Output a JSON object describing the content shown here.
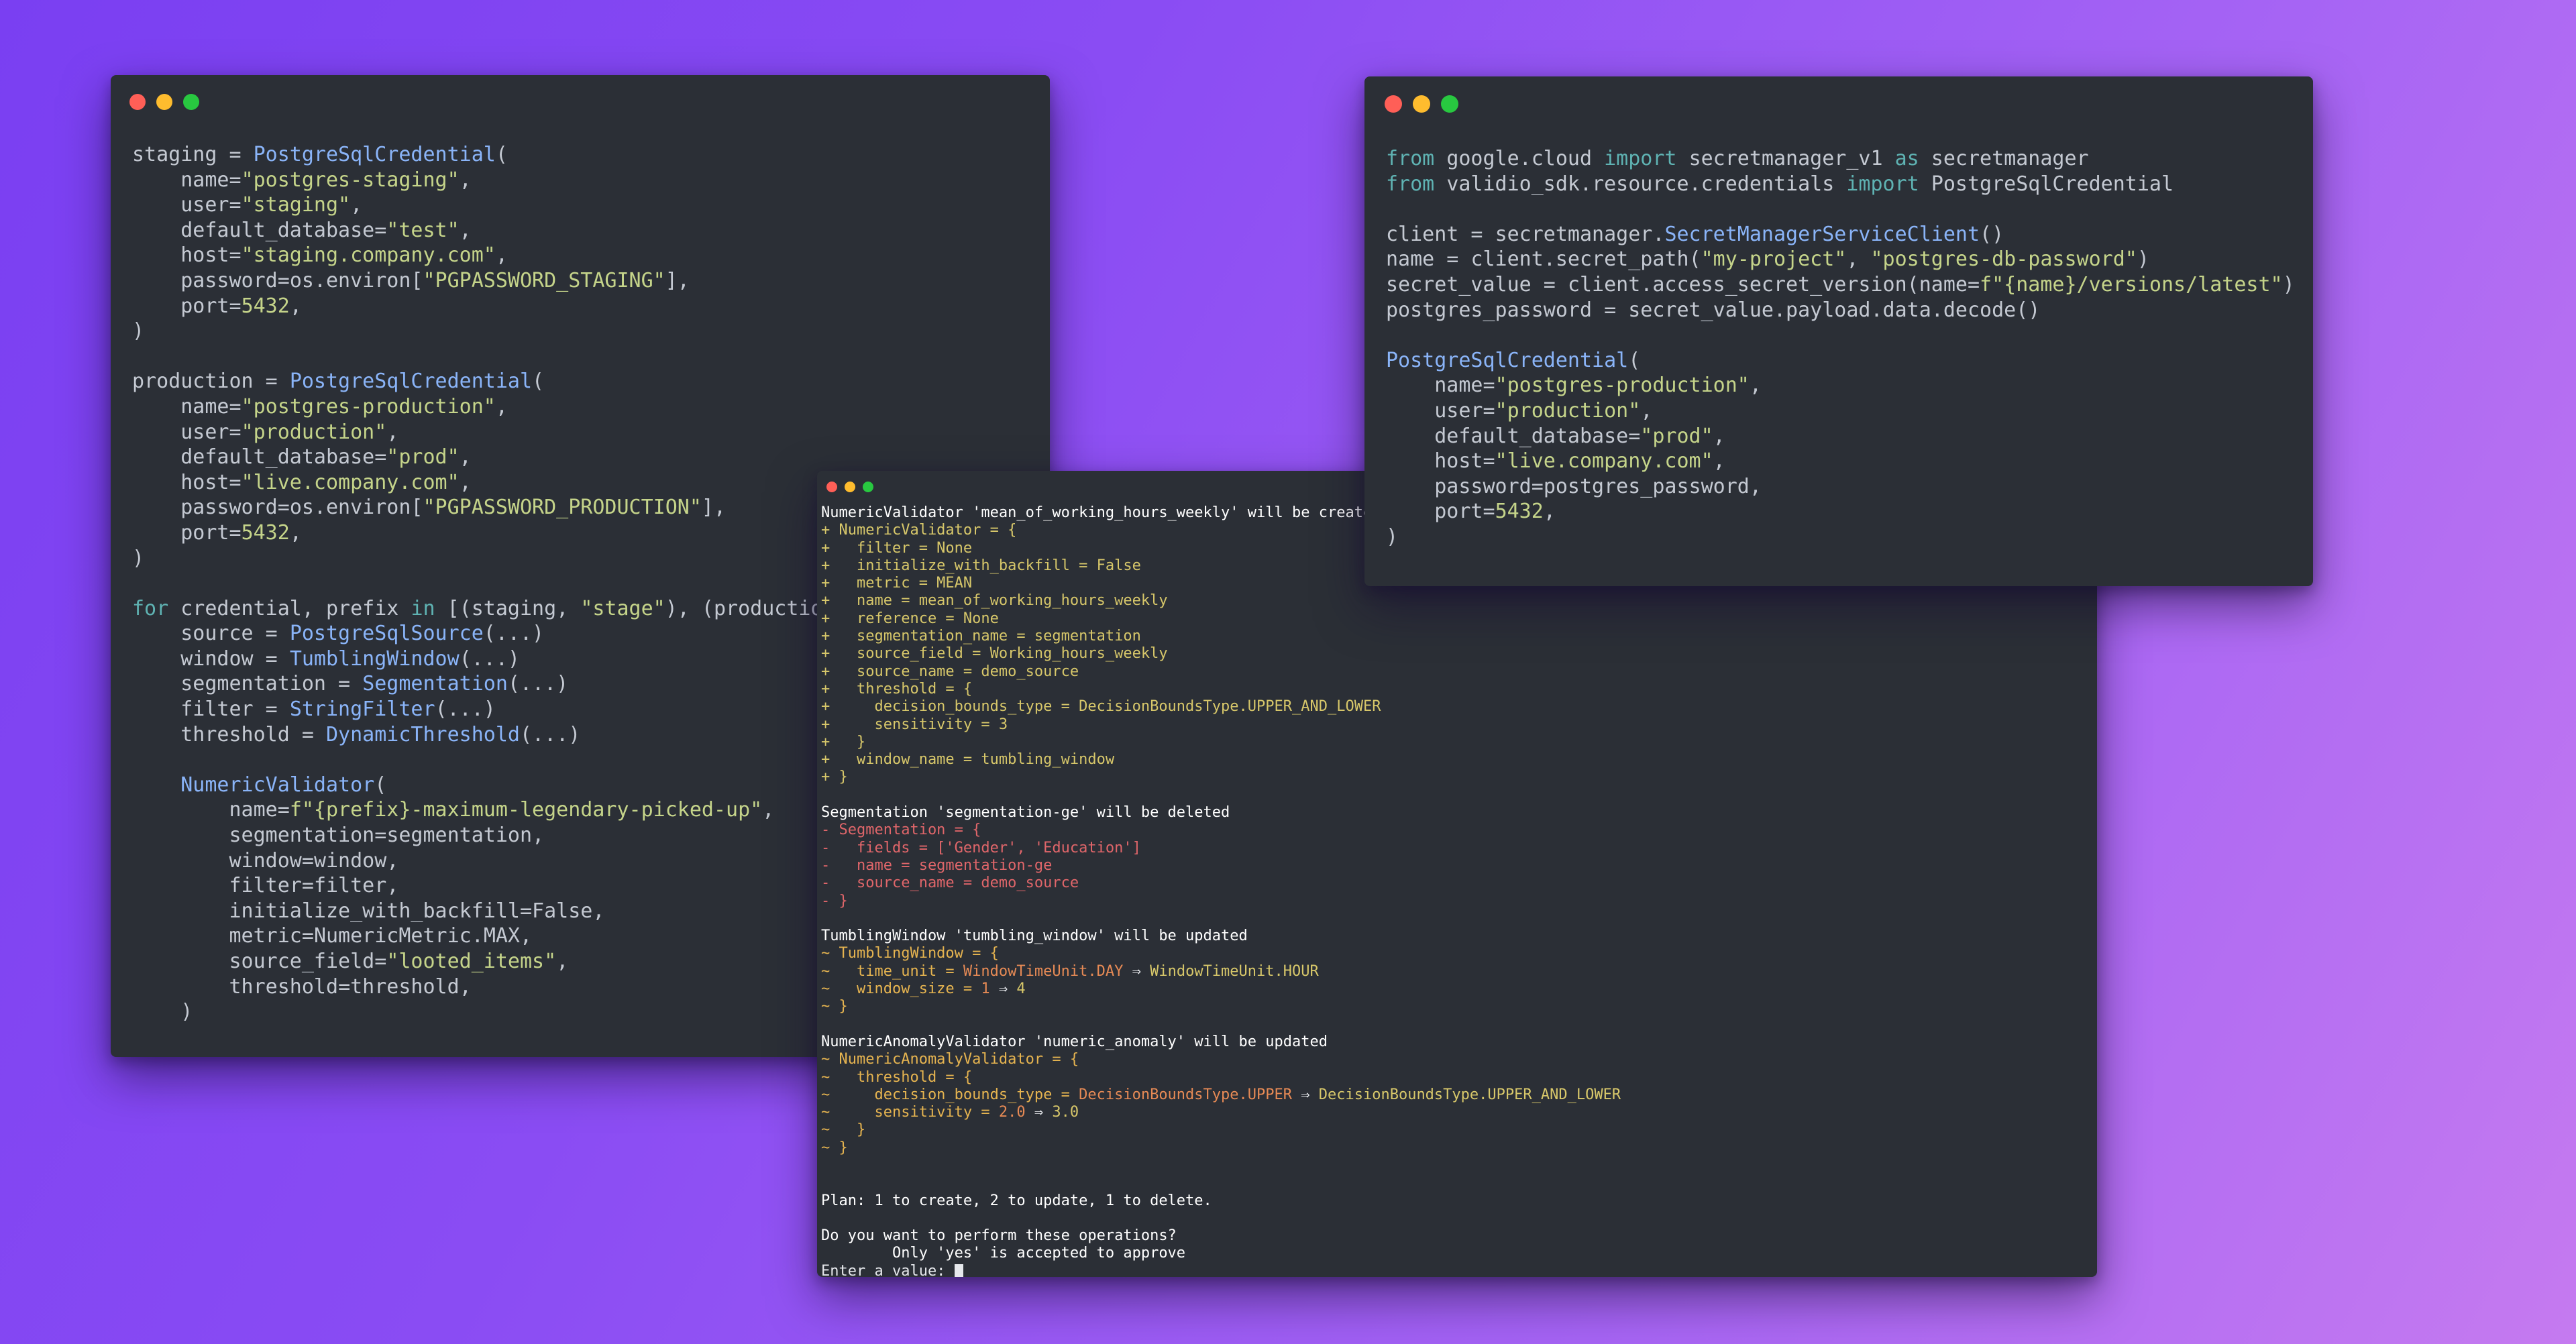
{
  "windows": {
    "left_editor": {
      "lines": [
        "staging = PostgreSqlCredential(",
        "    name=\"postgres-staging\",",
        "    user=\"staging\",",
        "    default_database=\"test\",",
        "    host=\"staging.company.com\",",
        "    password=os.environ[\"PGPASSWORD_STAGING\"],",
        "    port=5432,",
        ")",
        "",
        "production = PostgreSqlCredential(",
        "    name=\"postgres-production\",",
        "    user=\"production\",",
        "    default_database=\"prod\",",
        "    host=\"live.company.com\",",
        "    password=os.environ[\"PGPASSWORD_PRODUCTION\"],",
        "    port=5432,",
        ")",
        "",
        "for credential, prefix in [(staging, \"stage\"), (production,",
        "    source = PostgreSqlSource(...)",
        "    window = TumblingWindow(...)",
        "    segmentation = Segmentation(...)",
        "    filter = StringFilter(...)",
        "    threshold = DynamicThreshold(...)",
        "",
        "    NumericValidator(",
        "        name=f\"{prefix}-maximum-legendary-picked-up\",",
        "        segmentation=segmentation,",
        "        window=window,",
        "        filter=filter,",
        "        initialize_with_backfill=False,",
        "        metric=NumericMetric.MAX,",
        "        source_field=\"looted_items\",",
        "        threshold=threshold,",
        "    )"
      ]
    },
    "right_editor": {
      "lines": [
        "from google.cloud import secretmanager_v1 as secretmanager",
        "from validio_sdk.resource.credentials import PostgreSqlCredential",
        "",
        "client = secretmanager.SecretManagerServiceClient()",
        "name = client.secret_path(\"my-project\", \"postgres-db-password\")",
        "secret_value = client.access_secret_version(name=f\"{name}/versions/latest\")",
        "postgres_password = secret_value.payload.data.decode()",
        "",
        "PostgreSqlCredential(",
        "    name=\"postgres-production\",",
        "    user=\"production\",",
        "    default_database=\"prod\",",
        "    host=\"live.company.com\",",
        "    password=postgres_password,",
        "    port=5432,",
        ")"
      ]
    },
    "terminal": {
      "lines": [
        "NumericValidator 'mean_of_working_hours_weekly' will be created",
        "+ NumericValidator = {",
        "+   filter = None",
        "+   initialize_with_backfill = False",
        "+   metric = MEAN",
        "+   name = mean_of_working_hours_weekly",
        "+   reference = None",
        "+   segmentation_name = segmentation",
        "+   source_field = Working_hours_weekly",
        "+   source_name = demo_source",
        "+   threshold = {",
        "+     decision_bounds_type = DecisionBoundsType.UPPER_AND_LOWER",
        "+     sensitivity = 3",
        "+   }",
        "+   window_name = tumbling_window",
        "+ }",
        "",
        "Segmentation 'segmentation-ge' will be deleted",
        "- Segmentation = {",
        "-   fields = ['Gender', 'Education']",
        "-   name = segmentation-ge",
        "-   source_name = demo_source",
        "- }",
        "",
        "TumblingWindow 'tumbling_window' will be updated",
        "~ TumblingWindow = {",
        "~   time_unit = WindowTimeUnit.DAY ⇒ WindowTimeUnit.HOUR",
        "~   window_size = 1 ⇒ 4",
        "~ }",
        "",
        "NumericAnomalyValidator 'numeric_anomaly' will be updated",
        "~ NumericAnomalyValidator = {",
        "~   threshold = {",
        "~     decision_bounds_type = DecisionBoundsType.UPPER ⇒ DecisionBoundsType.UPPER_AND_LOWER",
        "~     sensitivity = 2.0 ⇒ 3.0",
        "~   }",
        "~ }",
        "",
        "",
        "Plan: 1 to create, 2 to update, 1 to delete.",
        "",
        "Do you want to perform these operations?",
        "        Only 'yes' is accepted to approve",
        "Enter a value: "
      ]
    }
  },
  "colors": {
    "background_start": "#7a3ff2",
    "background_end": "#c57af0",
    "window_bg": "#2b2f36",
    "keyword": "#5fb3b3",
    "string": "#c5d48a",
    "function": "#8ab4f8",
    "diff_add": "#d7c76a",
    "diff_delete": "#e0666a",
    "diff_update": "#e6b450"
  }
}
